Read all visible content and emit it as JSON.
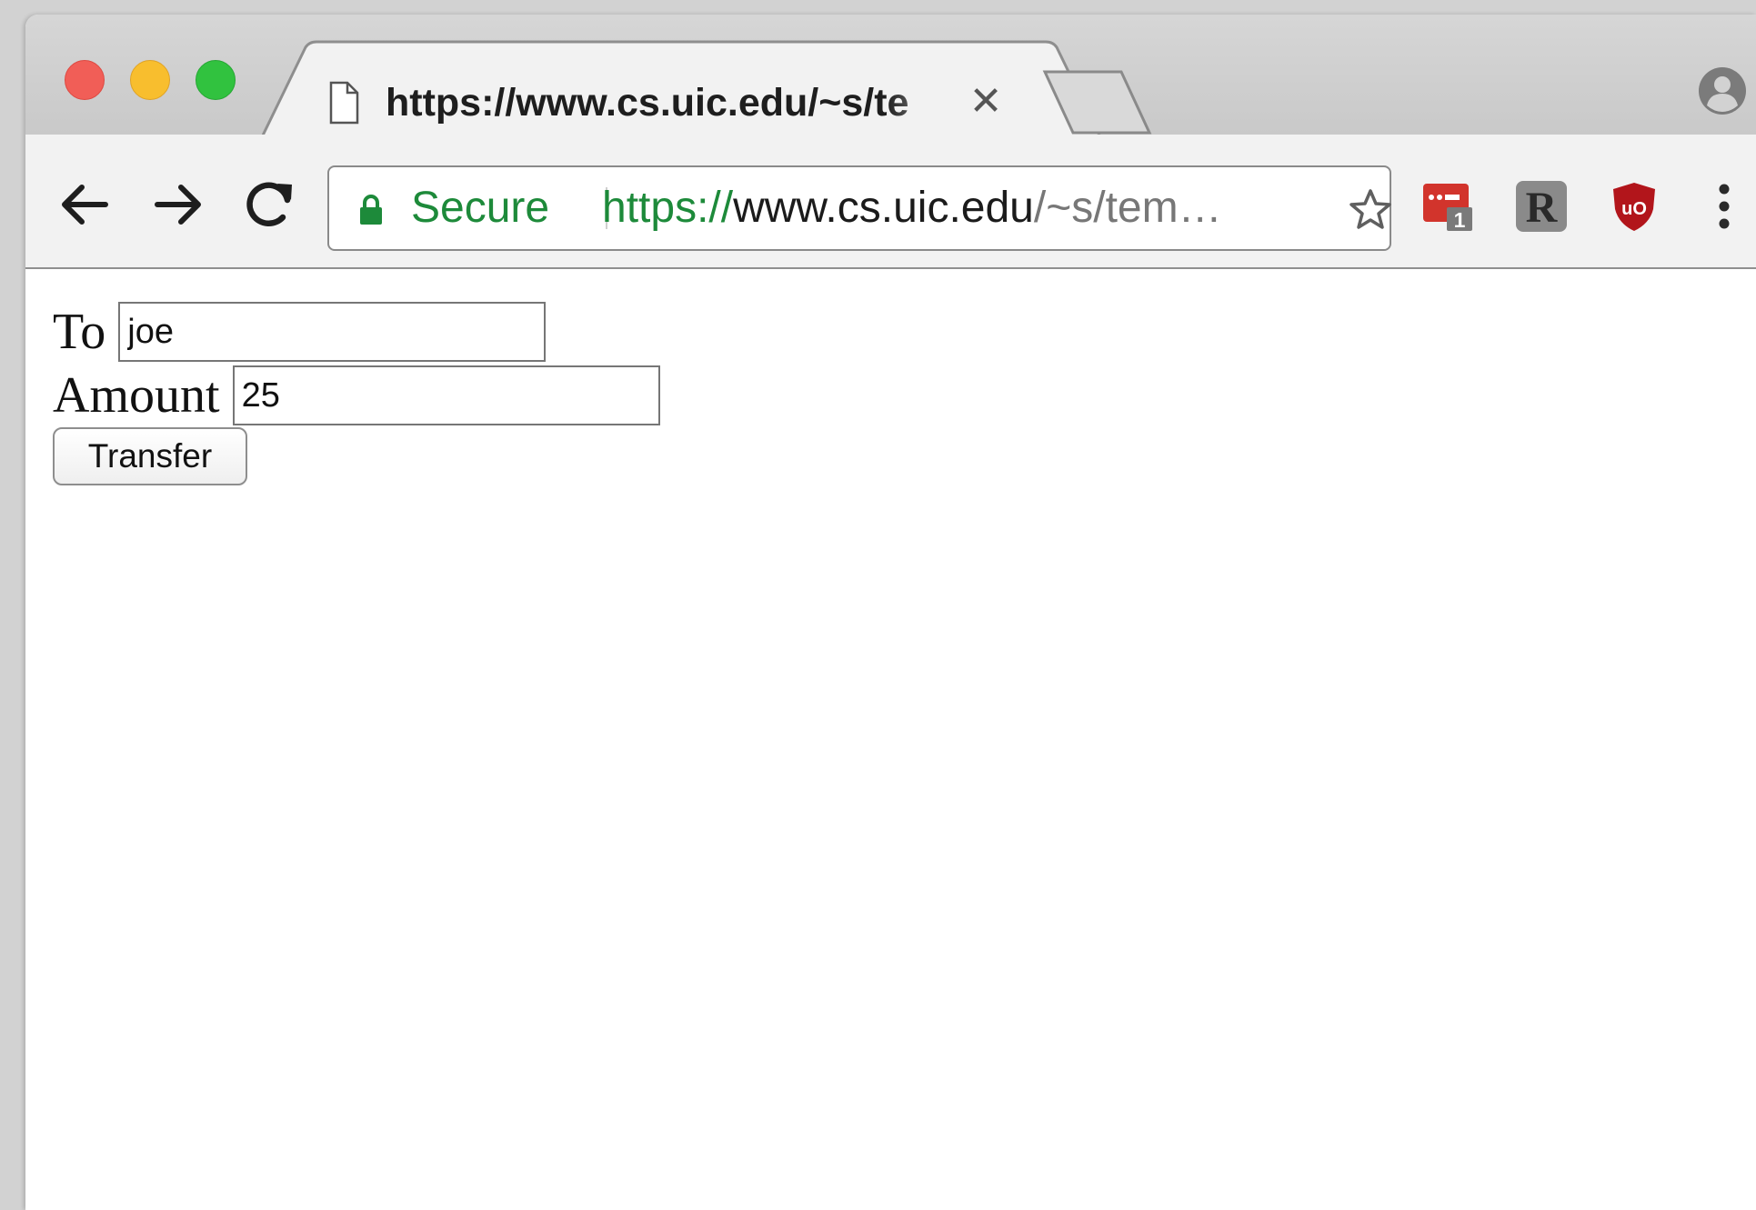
{
  "tab": {
    "title": "https://www.cs.uic.edu/~s/te",
    "close_glyph": "✕"
  },
  "address_bar": {
    "secure_label": "Secure",
    "url_scheme": "https://",
    "url_host": "www.cs.uic.edu",
    "url_path": "/~s/tem…"
  },
  "extensions": {
    "first_badge": "1",
    "second_letter": "R",
    "third_label": "uO"
  },
  "form": {
    "to_label": "To",
    "to_value": "joe",
    "amount_label": "Amount",
    "amount_value": "25",
    "submit_label": "Transfer"
  },
  "colors": {
    "secure_green": "#1d8a3a",
    "close_red": "#f15e57",
    "minimize_yellow": "#f8be2e",
    "zoom_green": "#31c23f",
    "extension_red": "#d2342c"
  }
}
